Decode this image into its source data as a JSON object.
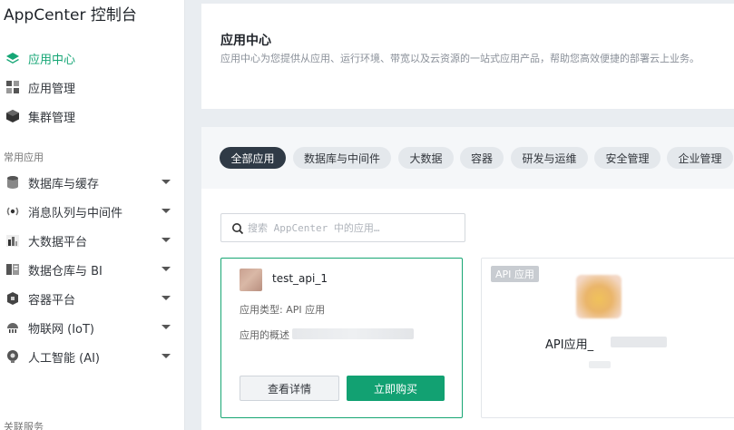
{
  "sidebar": {
    "brand": "AppCenter 控制台",
    "top_items": [
      {
        "label": "应用中心",
        "icon": "layers-icon",
        "active": true
      },
      {
        "label": "应用管理",
        "icon": "grid-icon"
      },
      {
        "label": "集群管理",
        "icon": "cube-icon"
      }
    ],
    "section_common": "常用应用",
    "common_items": [
      {
        "label": "数据库与缓存",
        "icon": "database-icon"
      },
      {
        "label": "消息队列与中间件",
        "icon": "broadcast-icon"
      },
      {
        "label": "大数据平台",
        "icon": "bar-chart-icon"
      },
      {
        "label": "数据仓库与 BI",
        "icon": "warehouse-icon"
      },
      {
        "label": "容器平台",
        "icon": "container-icon"
      },
      {
        "label": "物联网 (IoT)",
        "icon": "iot-icon"
      },
      {
        "label": "人工智能 (AI)",
        "icon": "ai-icon"
      }
    ],
    "section_related": "关联服务"
  },
  "header": {
    "title": "应用中心",
    "description": "应用中心为您提供从应用、运行环境、带宽以及云资源的一站式应用产品，帮助您高效便捷的部署云上业务。"
  },
  "tabs": [
    {
      "label": "全部应用",
      "active": true
    },
    {
      "label": "数据库与中间件"
    },
    {
      "label": "大数据"
    },
    {
      "label": "容器"
    },
    {
      "label": "研发与运维"
    },
    {
      "label": "安全管理"
    },
    {
      "label": "企业管理"
    }
  ],
  "search": {
    "placeholder": "搜索 AppCenter 中的应用…"
  },
  "cards": [
    {
      "name": "test_api_1",
      "type_text": "应用类型: API 应用",
      "summary_label": "应用的概述",
      "detail_button": "查看详情",
      "buy_button": "立即购买"
    },
    {
      "badge": "API 应用",
      "name": "API应用_"
    }
  ],
  "colors": {
    "accent_green": "#12a172",
    "active_tab": "#2f3a46"
  }
}
